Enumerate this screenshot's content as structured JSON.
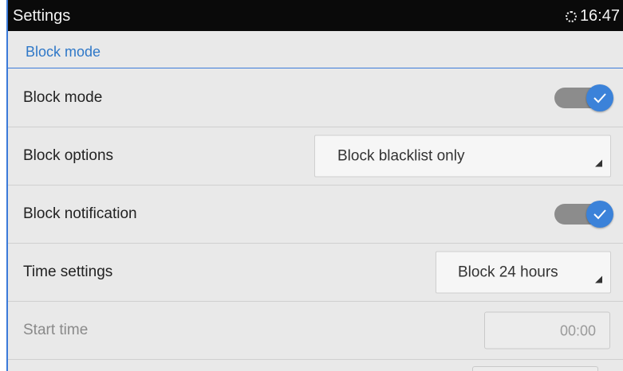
{
  "status_bar": {
    "title": "Settings",
    "time": "16:47",
    "sync_icon": "sync-icon"
  },
  "subheader": {
    "label": "Block mode"
  },
  "rows": [
    {
      "label": "Block mode",
      "control": "toggle",
      "checked": true
    },
    {
      "label": "Block options",
      "control": "dropdown",
      "value": "Block blacklist only"
    },
    {
      "label": "Block notification",
      "control": "toggle",
      "checked": true
    },
    {
      "label": "Time settings",
      "control": "dropdown",
      "value": "Block 24 hours"
    },
    {
      "label": "Start time",
      "control": "time",
      "value": "00:00",
      "disabled": true
    }
  ],
  "colors": {
    "accent": "#3b82d9",
    "status_bar": "#0a0a0a",
    "background": "#e9e9e9",
    "subheader_text": "#2f78c8"
  }
}
